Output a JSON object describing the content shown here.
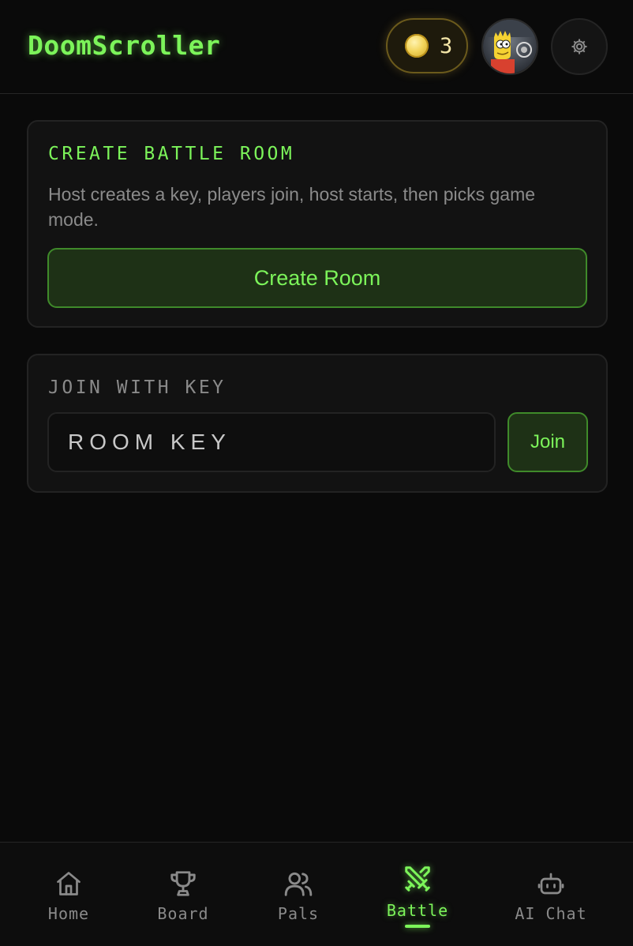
{
  "header": {
    "app_title": "DoomScroller",
    "coins": "3"
  },
  "create_room": {
    "heading": "CREATE BATTLE ROOM",
    "description": "Host creates a key, players join, host starts, then picks game mode.",
    "button_label": "Create Room"
  },
  "join_room": {
    "heading": "JOIN WITH KEY",
    "input_placeholder": "ROOM KEY",
    "input_value": "",
    "button_label": "Join"
  },
  "nav": {
    "items": [
      {
        "label": "Home",
        "icon": "home-icon",
        "active": false
      },
      {
        "label": "Board",
        "icon": "trophy-icon",
        "active": false
      },
      {
        "label": "Pals",
        "icon": "users-icon",
        "active": false
      },
      {
        "label": "Battle",
        "icon": "swords-icon",
        "active": true
      },
      {
        "label": "AI Chat",
        "icon": "bot-icon",
        "active": false
      }
    ]
  },
  "colors": {
    "accent": "#7cf45a",
    "background": "#0a0a0a",
    "card": "#121212",
    "muted_text": "#8a8a8a",
    "coin": "#f2d45a"
  }
}
